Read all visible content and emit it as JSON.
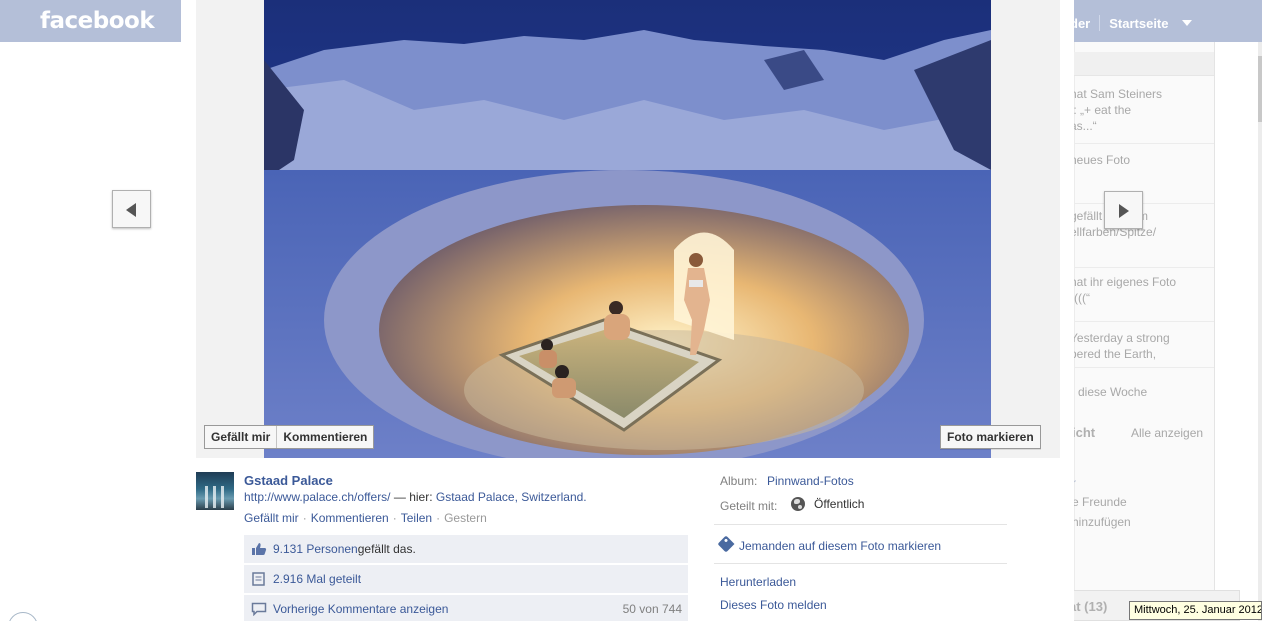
{
  "background": {
    "logo": "facebook",
    "nav": {
      "partial_item": "der",
      "home": "Startseite"
    },
    "ticker": [
      "hat Sam Steiners",
      "t: „+ eat the",
      "as...“",
      "neues Foto",
      "gefällt   s Album",
      "ellfarben/Spitze/",
      "hat ihr eigenes Foto",
      "((((“",
      "Yesterday a strong",
      "pered the Earth,"
    ],
    "this_week": "diese Woche",
    "section_title": "icht",
    "see_all": "Alle anzeigen",
    "friends_fragment": "e Freunde",
    "add_fragment": "hinzufügen",
    "r_fragment": "r",
    "chat": "at (13)"
  },
  "viewer": {
    "buttons": {
      "like": "Gefällt mir",
      "comment": "Kommentieren",
      "tag_photo": "Foto markieren"
    },
    "owner": "Gstaad Palace",
    "caption_url": "http://www.palace.ch/offers/",
    "caption_here": " — hier: ",
    "caption_place": "Gstaad Palace, Switzerland.",
    "actions": {
      "like": "Gefällt mir",
      "comment": "Kommentieren",
      "share": "Teilen",
      "timestamp": "Gestern"
    },
    "likes_count": "9.131 Personen",
    "likes_suffix": " gefällt das.",
    "shares": "2.916 Mal geteilt",
    "prev_comments": "Vorherige Kommentare anzeigen",
    "comment_count": "50 von 744",
    "album_label": "Album:",
    "album_name": "Pinnwand-Fotos",
    "shared_label": "Geteilt mit:",
    "shared_value": "Öffentlich",
    "tag_someone": "Jemanden auf diesem Foto markieren",
    "download": "Herunterladen",
    "report": "Dieses Foto melden"
  },
  "tooltip": "Mittwoch, 25. Januar 2012",
  "colors": {
    "link": "#3b5998",
    "topbar_dimmed": "#b4bfd8",
    "ufi_bg": "#edeff4"
  }
}
